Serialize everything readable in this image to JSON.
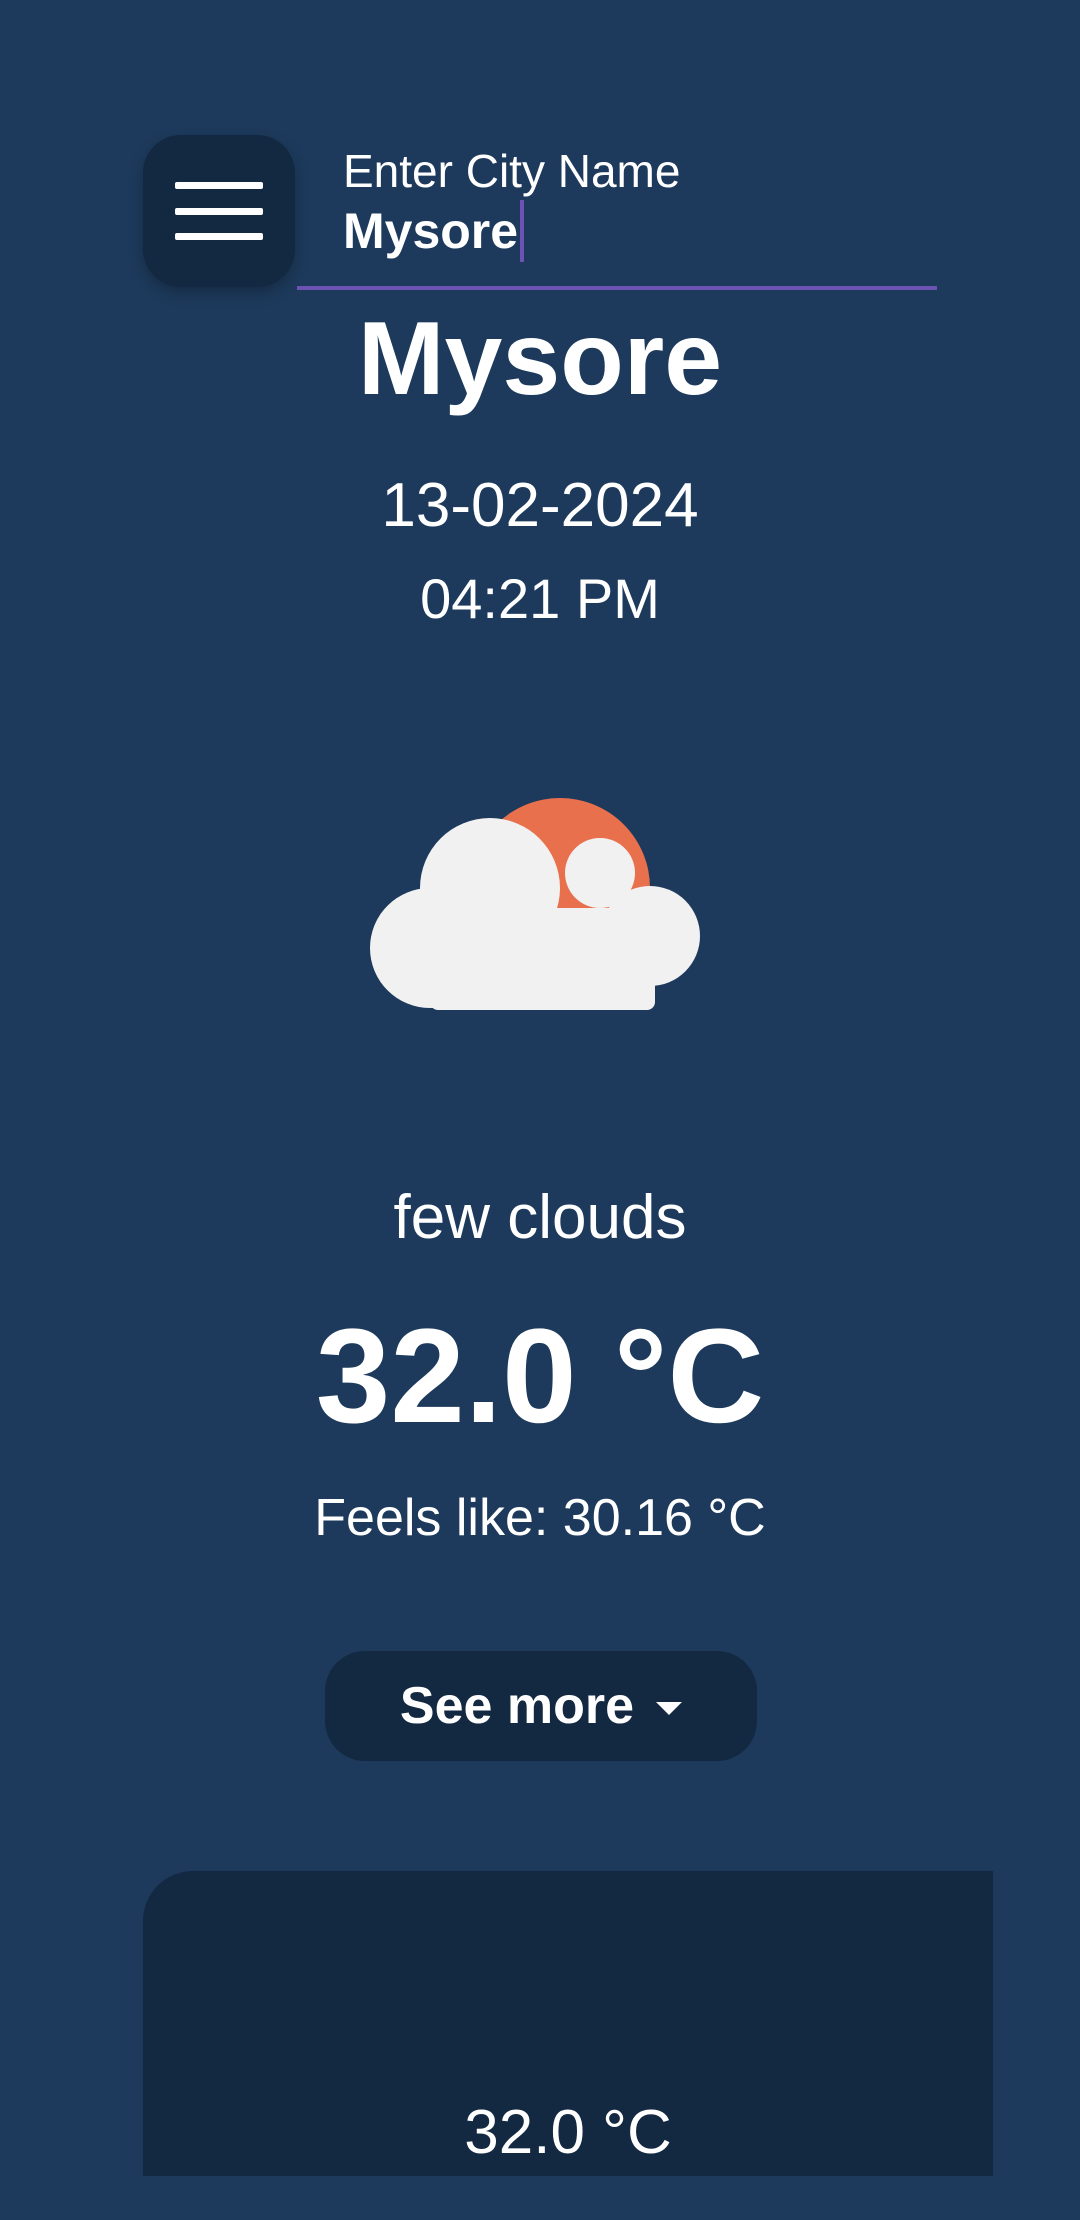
{
  "header": {
    "menu_icon": "hamburger-menu-icon",
    "city_input": {
      "label": "Enter City Name",
      "value": "Mysore"
    }
  },
  "current": {
    "city": "Mysore",
    "date": "13-02-2024",
    "time": "04:21 PM",
    "icon": "partly-cloudy-sun-icon",
    "description": "few clouds",
    "temperature": "32.0 °C",
    "feels_like": "Feels like: 30.16 °C"
  },
  "see_more": {
    "label": "See more",
    "icon": "chevron-down-icon"
  },
  "forecast_card": {
    "temperature": "32.0 °C"
  },
  "colors": {
    "background": "#1d3a5c",
    "surface": "#132841",
    "accent": "#6b52b3",
    "sun": "#e8704d",
    "cloud": "#f1f1f2",
    "text": "#ffffff"
  }
}
